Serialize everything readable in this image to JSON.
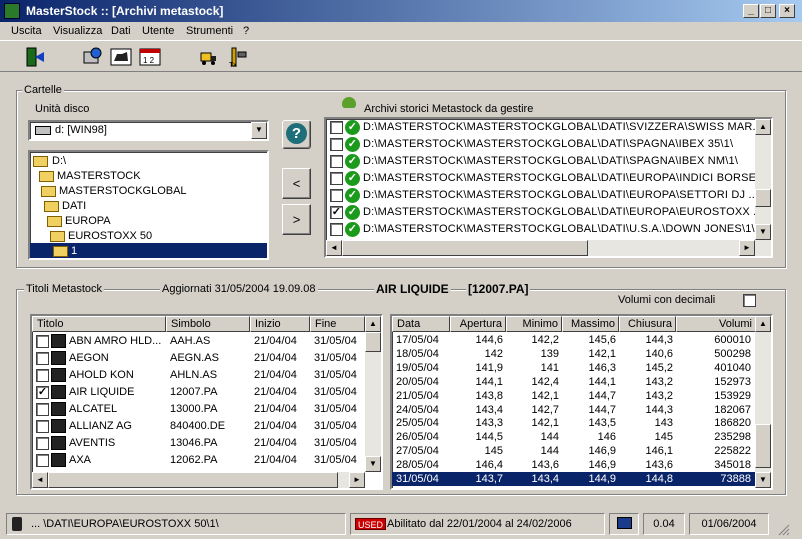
{
  "window": {
    "title": "MasterStock :: [Archivi metastock]"
  },
  "menu": [
    "Uscita",
    "Visualizza",
    "Dati",
    "Utente",
    "Strumenti",
    "?"
  ],
  "cartelle": {
    "label": "Cartelle",
    "unita_label": "Unità disco",
    "drive": "d: [WIN98]",
    "tree": [
      "D:\\",
      "MASTERSTOCK",
      "MASTERSTOCKGLOBAL",
      "DATI",
      "EUROPA",
      "EUROSTOXX 50",
      "1"
    ],
    "archivi_label": "Archivi storici Metastock da gestire",
    "archivi": [
      {
        "checked": false,
        "path": "D:\\MASTERSTOCK\\MASTERSTOCKGLOBAL\\DATI\\SVIZZERA\\SWISS MAR..."
      },
      {
        "checked": false,
        "path": "D:\\MASTERSTOCK\\MASTERSTOCKGLOBAL\\DATI\\SPAGNA\\IBEX 35\\1\\"
      },
      {
        "checked": false,
        "path": "D:\\MASTERSTOCK\\MASTERSTOCKGLOBAL\\DATI\\SPAGNA\\IBEX NM\\1\\"
      },
      {
        "checked": false,
        "path": "D:\\MASTERSTOCK\\MASTERSTOCKGLOBAL\\DATI\\EUROPA\\INDICI BORSE..."
      },
      {
        "checked": false,
        "path": "D:\\MASTERSTOCK\\MASTERSTOCKGLOBAL\\DATI\\EUROPA\\SETTORI DJ ..."
      },
      {
        "checked": true,
        "path": "D:\\MASTERSTOCK\\MASTERSTOCKGLOBAL\\DATI\\EUROPA\\EUROSTOXX ..."
      },
      {
        "checked": false,
        "path": "D:\\MASTERSTOCK\\MASTERSTOCKGLOBAL\\DATI\\U.S.A.\\DOWN JONES\\1\\"
      }
    ],
    "btn_left": "<",
    "btn_right": ">",
    "help": "?"
  },
  "titoli": {
    "label": "Titoli Metastock",
    "aggiornati": "Aggiornati 31/05/2004 19.09.08",
    "selected_name": "AIR LIQUIDE",
    "selected_code": "[12007.PA]",
    "volumi_decimali": "Volumi con decimali",
    "columns": [
      "Titolo",
      "Simbolo",
      "Inizio",
      "Fine"
    ],
    "rows": [
      {
        "checked": false,
        "titolo": "ABN AMRO HLD...",
        "simbolo": "AAH.AS",
        "inizio": "21/04/04",
        "fine": "31/05/04"
      },
      {
        "checked": false,
        "titolo": "AEGON",
        "simbolo": "AEGN.AS",
        "inizio": "21/04/04",
        "fine": "31/05/04"
      },
      {
        "checked": false,
        "titolo": "AHOLD KON",
        "simbolo": "AHLN.AS",
        "inizio": "21/04/04",
        "fine": "31/05/04"
      },
      {
        "checked": true,
        "titolo": "AIR LIQUIDE",
        "simbolo": "12007.PA",
        "inizio": "21/04/04",
        "fine": "31/05/04"
      },
      {
        "checked": false,
        "titolo": "ALCATEL",
        "simbolo": "13000.PA",
        "inizio": "21/04/04",
        "fine": "31/05/04"
      },
      {
        "checked": false,
        "titolo": "ALLIANZ AG",
        "simbolo": "840400.DE",
        "inizio": "21/04/04",
        "fine": "31/05/04"
      },
      {
        "checked": false,
        "titolo": "AVENTIS",
        "simbolo": "13046.PA",
        "inizio": "21/04/04",
        "fine": "31/05/04"
      },
      {
        "checked": false,
        "titolo": "AXA",
        "simbolo": "12062.PA",
        "inizio": "21/04/04",
        "fine": "31/05/04"
      }
    ]
  },
  "quotes": {
    "columns": [
      "Data",
      "Apertura",
      "Minimo",
      "Massimo",
      "Chiusura",
      "Volumi"
    ],
    "rows": [
      [
        "17/05/04",
        "144,6",
        "142,2",
        "145,6",
        "144,3",
        "600010"
      ],
      [
        "18/05/04",
        "142",
        "139",
        "142,1",
        "140,6",
        "500298"
      ],
      [
        "19/05/04",
        "141,9",
        "141",
        "146,3",
        "145,2",
        "401040"
      ],
      [
        "20/05/04",
        "144,1",
        "142,4",
        "144,1",
        "143,2",
        "152973"
      ],
      [
        "21/05/04",
        "143,8",
        "142,1",
        "144,7",
        "143,2",
        "153929"
      ],
      [
        "24/05/04",
        "143,4",
        "142,7",
        "144,7",
        "144,3",
        "182067"
      ],
      [
        "25/05/04",
        "143,3",
        "142,1",
        "143,5",
        "143",
        "186820"
      ],
      [
        "26/05/04",
        "144,5",
        "144",
        "146",
        "145",
        "235298"
      ],
      [
        "27/05/04",
        "145",
        "144",
        "146,9",
        "146,1",
        "225822"
      ],
      [
        "28/05/04",
        "146,4",
        "143,6",
        "146,9",
        "143,6",
        "345018"
      ],
      [
        "31/05/04",
        "143,7",
        "143,4",
        "144,9",
        "144,8",
        "73888"
      ]
    ]
  },
  "status": {
    "path": "... \\DATI\\EUROPA\\EUROSTOXX 50\\1\\",
    "used": "USED",
    "abilitato": "Abilitato dal 22/01/2004 al 24/02/2006",
    "time": "0.04",
    "date": "01/06/2004"
  },
  "colors": {
    "titlebar": "#0a246a",
    "selection": "#0a246a",
    "ok": "#1c9a1c",
    "used": "#cc0000"
  }
}
